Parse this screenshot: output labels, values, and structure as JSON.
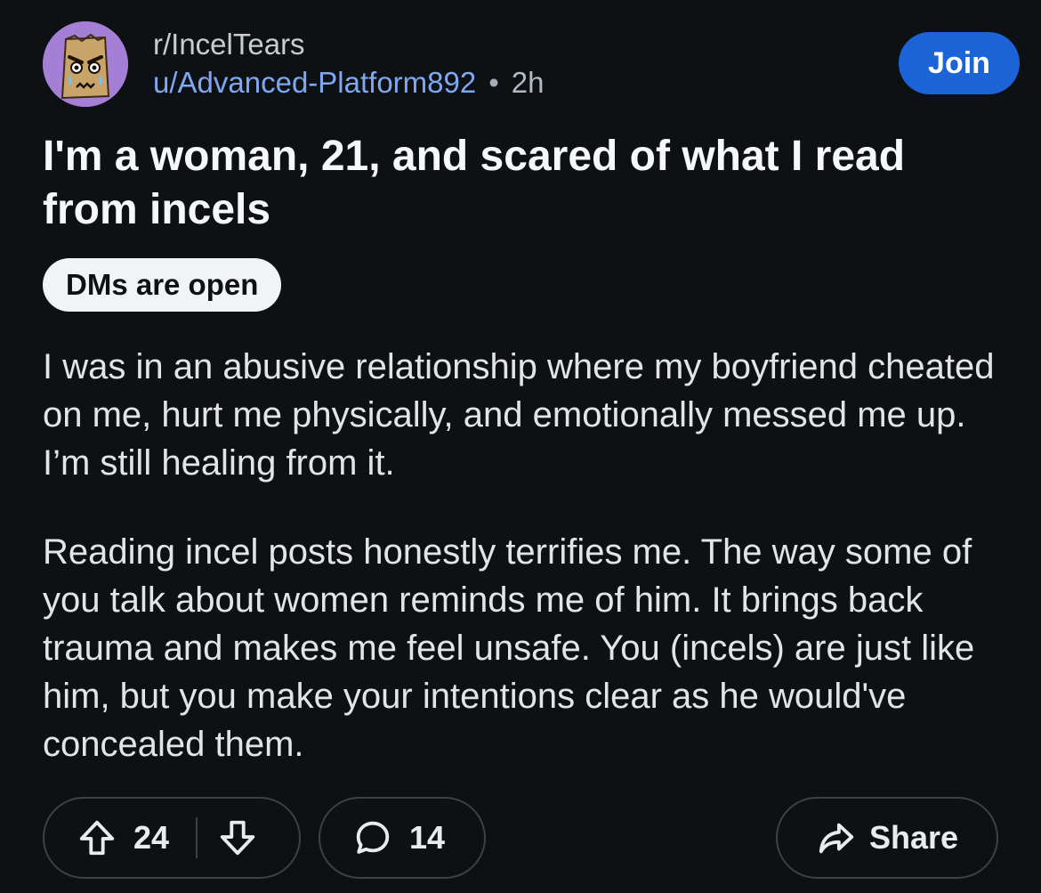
{
  "post": {
    "subreddit": "r/IncelTears",
    "username": "u/Advanced-Platform892",
    "separator": "•",
    "age": "2h",
    "join_label": "Join",
    "title": "I'm a woman, 21, and scared of what I read from incels",
    "flair": "DMs are open",
    "body": [
      "I was in an abusive relationship where my boyfriend cheated on me, hurt me physically, and emotionally messed me up. I’m still healing from it.",
      "Reading incel posts honestly terrifies me. The way some of you talk about women reminds me of him. It brings back trauma and makes me feel unsafe. You (incels) are just like him, but you make your intentions clear as he would've concealed them."
    ]
  },
  "actions": {
    "upvotes": "24",
    "comments": "14",
    "share_label": "Share"
  },
  "colors": {
    "background": "#0e1113",
    "accent": "#1b63d6",
    "username": "#7ea8f2",
    "avatar_bg": "#a57fd6"
  },
  "icons": {
    "avatar": "paper-bag-crying-face",
    "upvote": "arrow-up-outline-icon",
    "downvote": "arrow-down-outline-icon",
    "comment": "speech-bubble-icon",
    "share": "share-arrow-icon"
  }
}
